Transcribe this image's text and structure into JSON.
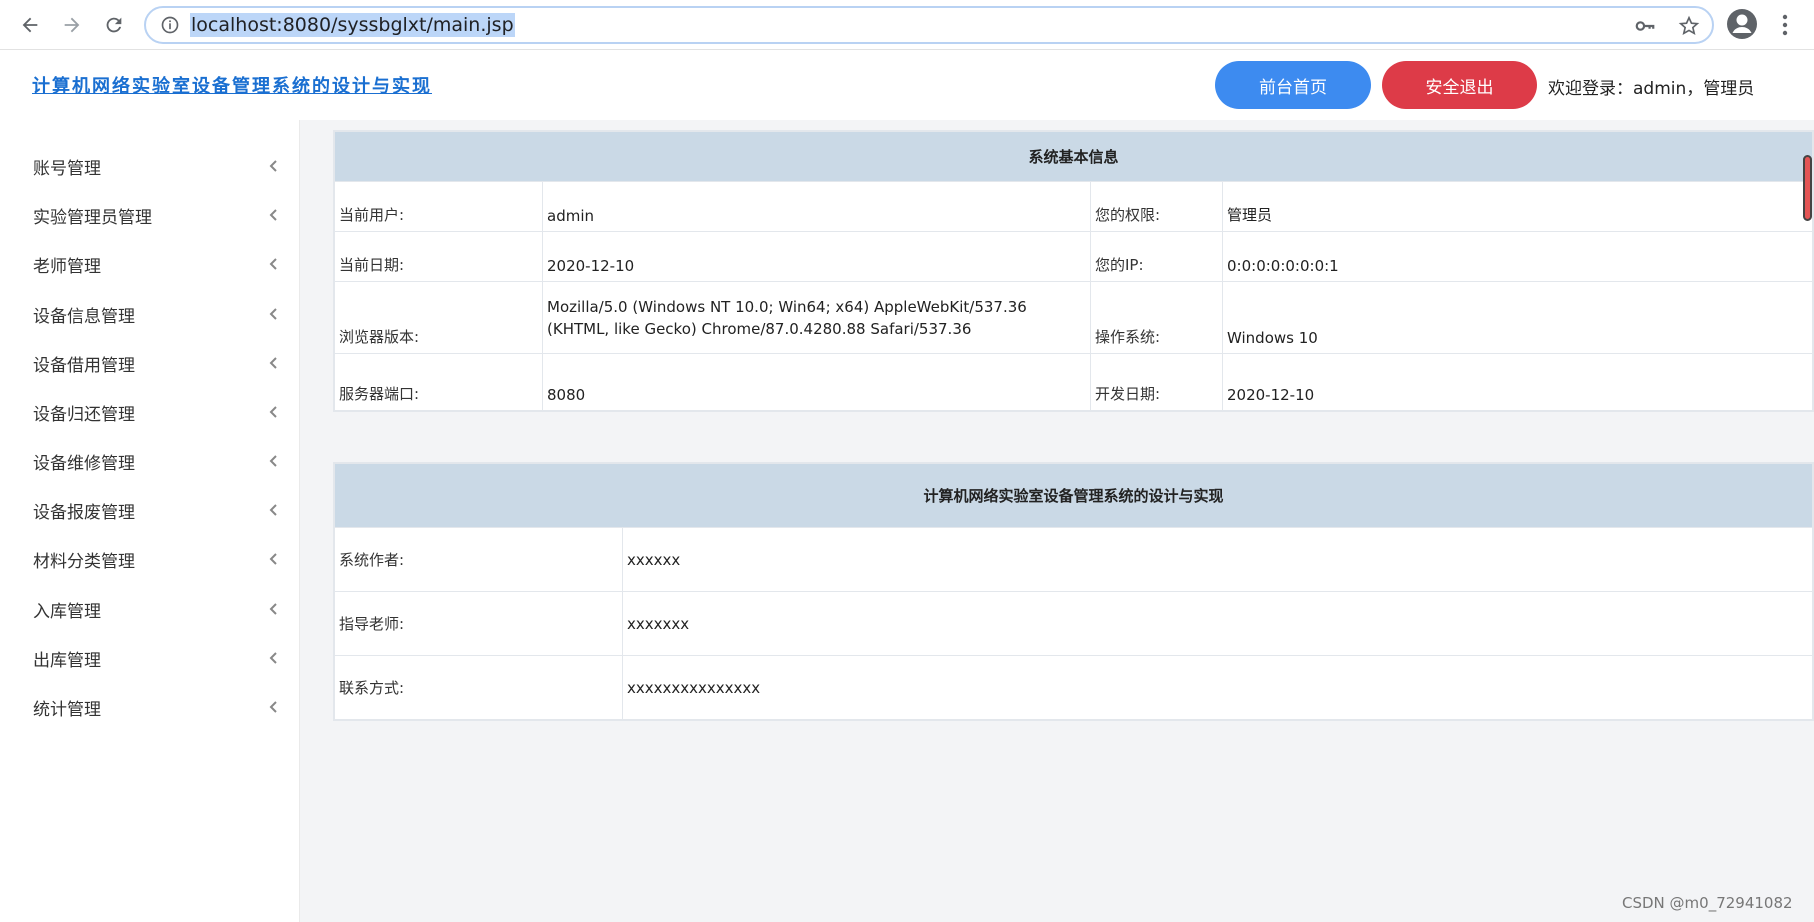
{
  "browser": {
    "url": "localhost:8080/syssbglxt/main.jsp",
    "icons": [
      "back-arrow-icon",
      "forward-arrow-icon",
      "reload-icon",
      "info-icon",
      "key-icon",
      "star-icon",
      "profile-icon",
      "menu-dots-icon"
    ]
  },
  "header": {
    "title": "计算机网络实验室设备管理系统的设计与实现",
    "home_button": "前台首页",
    "logout_button": "安全退出",
    "welcome": "欢迎登录：admin，管理员",
    "colors": {
      "home": "#3d8bf0",
      "logout": "#dd3b48",
      "title": "#1a6fd1"
    }
  },
  "sidebar": {
    "items": [
      {
        "label": "账号管理"
      },
      {
        "label": "实验管理员管理"
      },
      {
        "label": "老师管理"
      },
      {
        "label": "设备信息管理"
      },
      {
        "label": "设备借用管理"
      },
      {
        "label": "设备归还管理"
      },
      {
        "label": "设备维修管理"
      },
      {
        "label": "设备报废管理"
      },
      {
        "label": "材料分类管理"
      },
      {
        "label": "入库管理"
      },
      {
        "label": "出库管理"
      },
      {
        "label": "统计管理"
      }
    ]
  },
  "system_info": {
    "title": "系统基本信息",
    "rows": [
      {
        "l1": "当前用户:",
        "v1": "admin",
        "l2": "您的权限:",
        "v2": "管理员"
      },
      {
        "l1": "当前日期:",
        "v1": "2020-12-10",
        "l2": "您的IP:",
        "v2": "0:0:0:0:0:0:0:1"
      },
      {
        "l1": "浏览器版本:",
        "v1a": "Mozilla/5.0 (Windows NT 10.0; Win64; x64) AppleWebKit/537.36",
        "v1b": "(KHTML, like Gecko) Chrome/87.0.4280.88 Safari/537.36",
        "l2": "操作系统:",
        "v2": "Windows 10"
      },
      {
        "l1": "服务器端口:",
        "v1": "8080",
        "l2": "开发日期:",
        "v2": "2020-12-10"
      }
    ]
  },
  "project_info": {
    "title": "计算机网络实验室设备管理系统的设计与实现",
    "rows": [
      {
        "label": "系统作者:",
        "value": "xxxxxx"
      },
      {
        "label": "指导老师:",
        "value": "xxxxxxx"
      },
      {
        "label": "联系方式:",
        "value": "xxxxxxxxxxxxxxx"
      }
    ]
  },
  "watermark": "CSDN @m0_72941082"
}
